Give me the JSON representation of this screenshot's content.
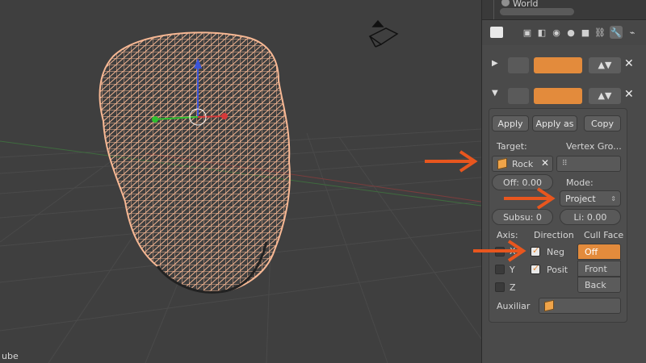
{
  "viewport": {
    "object_label": "ube"
  },
  "outliner": {
    "world_label": "World"
  },
  "modifier": {
    "buttons": {
      "apply": "Apply",
      "apply_as": "Apply as",
      "copy": "Copy"
    },
    "target_label": "Target:",
    "target_value": "Rock",
    "vertex_group_label": "Vertex Gro...",
    "offset_value": "Off: 0.00",
    "mode_label": "Mode:",
    "mode_value": "Project",
    "subsurf_value": "Subsu: 0",
    "limit_value": "Li: 0.00",
    "axis_label": "Axis:",
    "direction_label": "Direction",
    "cull_face_label": "Cull Face",
    "axes": [
      "X",
      "Y",
      "Z"
    ],
    "direction_neg": "Neg",
    "direction_pos": "Posit",
    "cull_options": [
      "Off",
      "Front",
      "Back"
    ],
    "auxiliary_label": "Auxiliar"
  },
  "colors": {
    "accent": "#e38b3c",
    "wire": "#f7b894",
    "annotation_arrow": "#e8561e"
  }
}
